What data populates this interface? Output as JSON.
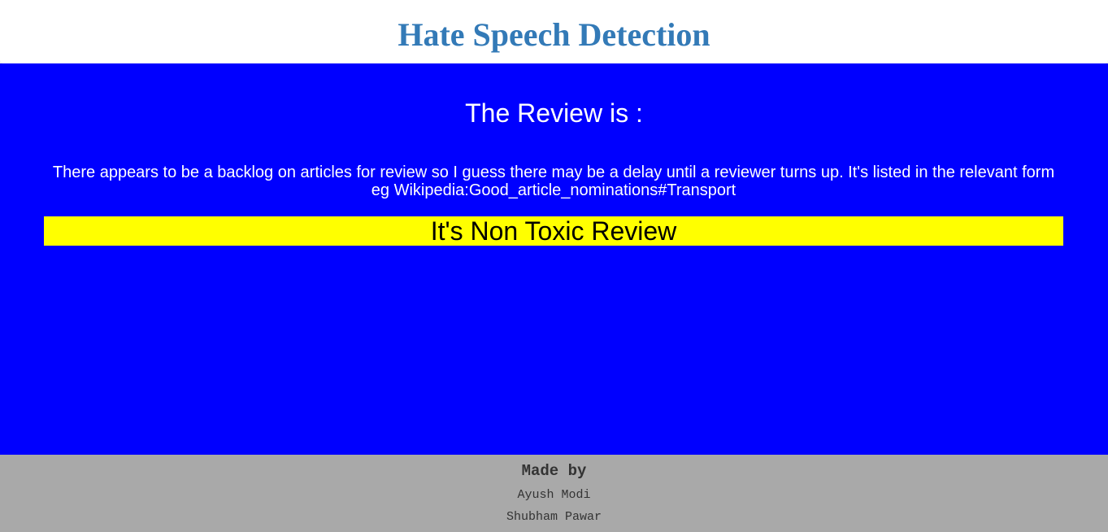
{
  "header": {
    "title": "Hate Speech Detection"
  },
  "main": {
    "heading": "The Review is :",
    "review_text": "There appears to be a backlog on articles for review so I guess there may be a delay until a reviewer turns up. It's listed in the relevant form eg Wikipedia:Good_article_nominations#Transport",
    "result": "It's Non Toxic Review"
  },
  "footer": {
    "made_by": "Made by",
    "authors": [
      "Ayush Modi",
      "Shubham Pawar"
    ]
  },
  "colors": {
    "header_title": "#337ab7",
    "main_background": "#0000ff",
    "result_background": "#ffff00",
    "footer_background": "#a9a9a9"
  }
}
